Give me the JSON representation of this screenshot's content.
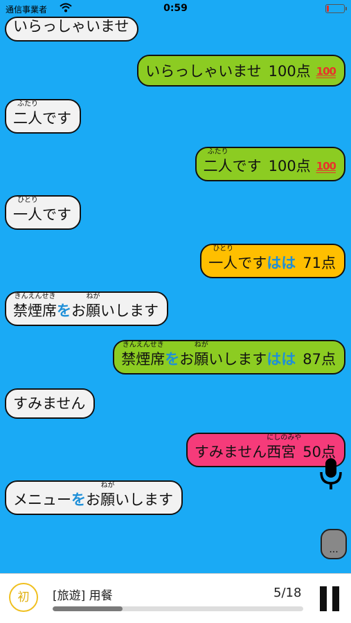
{
  "status_bar": {
    "carrier": "通信事業者",
    "time": "0:59"
  },
  "messages": [
    {
      "role": "prompt",
      "segments": [
        {
          "text": "いらっしゃいませ"
        }
      ]
    },
    {
      "role": "response",
      "color": "#8ccc22",
      "segments": [
        {
          "text": "いらっしゃいませ"
        }
      ],
      "score": "100点",
      "badge": "100"
    },
    {
      "role": "prompt",
      "segments": [
        {
          "text": "二人",
          "ruby": "ふたり"
        },
        {
          "text": "です"
        }
      ]
    },
    {
      "role": "response",
      "color": "#8ccc22",
      "segments": [
        {
          "text": "二人",
          "ruby": "ふたり"
        },
        {
          "text": "です"
        }
      ],
      "score": "100点",
      "badge": "100"
    },
    {
      "role": "prompt",
      "segments": [
        {
          "text": "一人",
          "ruby": "ひとり"
        },
        {
          "text": "です"
        }
      ]
    },
    {
      "role": "response",
      "color": "#ffbf00",
      "segments": [
        {
          "text": "一人",
          "ruby": "ひとり"
        },
        {
          "text": "です"
        }
      ],
      "extra": "はは",
      "score": "71点"
    },
    {
      "role": "prompt",
      "segments": [
        {
          "text": "禁煙席",
          "ruby": "きんえんせき"
        },
        {
          "text": "を",
          "hl": true
        },
        {
          "text": "お"
        },
        {
          "text": "願",
          "ruby": "ねが"
        },
        {
          "text": "いします"
        }
      ]
    },
    {
      "role": "response",
      "color": "#8ccc22",
      "segments": [
        {
          "text": "禁煙席",
          "ruby": "きんえんせき"
        },
        {
          "text": "を",
          "hl": true
        },
        {
          "text": "お"
        },
        {
          "text": "願",
          "ruby": "ねが"
        },
        {
          "text": "いします"
        }
      ],
      "extra": "はは",
      "score": "87点"
    },
    {
      "role": "prompt",
      "segments": [
        {
          "text": "すみません"
        }
      ]
    },
    {
      "role": "response",
      "color": "#f63b7a",
      "segments": [
        {
          "text": "すみません "
        },
        {
          "text": "西宮",
          "ruby": "にしのみや"
        }
      ],
      "score": "50点"
    },
    {
      "role": "prompt",
      "segments": [
        {
          "text": "メニュー"
        },
        {
          "text": "を",
          "hl": true
        },
        {
          "text": "お"
        },
        {
          "text": "願",
          "ruby": "ねが"
        },
        {
          "text": "いします"
        }
      ]
    }
  ],
  "more_button": {
    "label": "..."
  },
  "bottom_bar": {
    "level_badge": "初",
    "lesson_title": "[旅遊] 用餐",
    "progress_text": "5/18",
    "progress_fraction": 0.2778
  }
}
